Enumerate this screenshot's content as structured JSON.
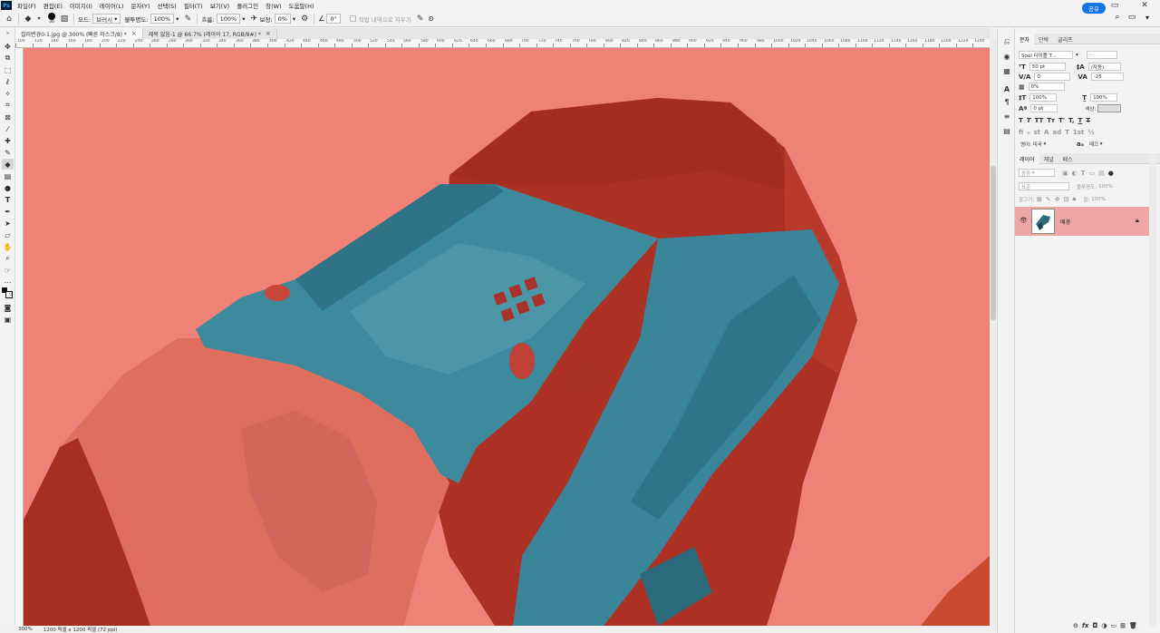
{
  "menu": {
    "logo": "Ps",
    "items": [
      "파일(F)",
      "편집(E)",
      "이미지(I)",
      "레이어(L)",
      "문자(Y)",
      "선택(S)",
      "필터(T)",
      "보기(V)",
      "플러그인",
      "창(W)",
      "도움말(H)"
    ]
  },
  "options": {
    "brush_size": "30",
    "mode_label": "모드:",
    "mode_value": "브러시",
    "opacity_label": "불투명도:",
    "opacity_value": "100%",
    "flow_label": "흐름:",
    "flow_value": "100%",
    "smoothing_label": "보정:",
    "smoothing_value": "0%",
    "angle_value": "0°",
    "erase_history_label": "작업 내역으로 지우기",
    "share_label": "공유"
  },
  "tabs": [
    {
      "label": "컬러변경0-1.jpg @ 300% (빠른 마스크/8) *",
      "active": true
    },
    {
      "label": "제목 없음-1 @ 66.7% (레이어 17, RGB/8#) *",
      "active": false
    }
  ],
  "ruler": {
    "labels": [
      "100",
      "120",
      "140",
      "160",
      "180",
      "200",
      "220",
      "240",
      "260",
      "280",
      "300",
      "320",
      "340",
      "360",
      "380",
      "400",
      "420",
      "440",
      "460",
      "480",
      "500",
      "520",
      "540",
      "560",
      "580",
      "600",
      "620",
      "640",
      "660",
      "680",
      "700",
      "720",
      "740",
      "760",
      "780",
      "800",
      "820",
      "840",
      "860",
      "880",
      "900",
      "920",
      "940",
      "960",
      "980",
      "1000",
      "1020",
      "1040",
      "1060",
      "1080",
      "1100",
      "1120",
      "1140",
      "1160",
      "1180",
      "1200",
      "1220",
      "1240"
    ]
  },
  "status": {
    "zoom": "300%",
    "doc_info": "1200 픽셀 x 1200 픽셀 (72 ppi)"
  },
  "character_panel": {
    "tabs": [
      "문자",
      "단락",
      "글리프"
    ],
    "font_family": "Soul 타이틀 T...",
    "font_style": "-",
    "font_size": "50 pt",
    "leading": "(자동)",
    "kerning": "0",
    "tracking": "-25",
    "tsume": "0%",
    "vertical_scale": "100%",
    "horizontal_scale": "100%",
    "baseline": "0 pt",
    "color_label": "색상:",
    "style_buttons": [
      "T",
      "T",
      "TT",
      "Tт",
      "T'",
      "T,",
      "T",
      "T"
    ],
    "opentype_buttons": [
      "fi",
      "ℴ",
      "st",
      "A",
      "ad",
      "T",
      "1st",
      "½"
    ],
    "language": "영어: 미국",
    "antialias_label": "aₐ",
    "antialias": "매끄"
  },
  "layers_panel": {
    "tabs": [
      "레이어",
      "채널",
      "패스"
    ],
    "filter_placeholder": "종류",
    "blend_mode": "표준",
    "opacity_label": "불투명도:",
    "opacity_value": "100%",
    "lock_label": "잠그기:",
    "fill_label": "칠:",
    "fill_value": "100%",
    "layer_name": "배경"
  },
  "colors": {
    "canvas_bg": "#ef8177",
    "mask_dark": "#b33a2c",
    "teal": "#3d8a9c",
    "accent": "#1473e6",
    "layer_selected": "#eda8a6"
  }
}
